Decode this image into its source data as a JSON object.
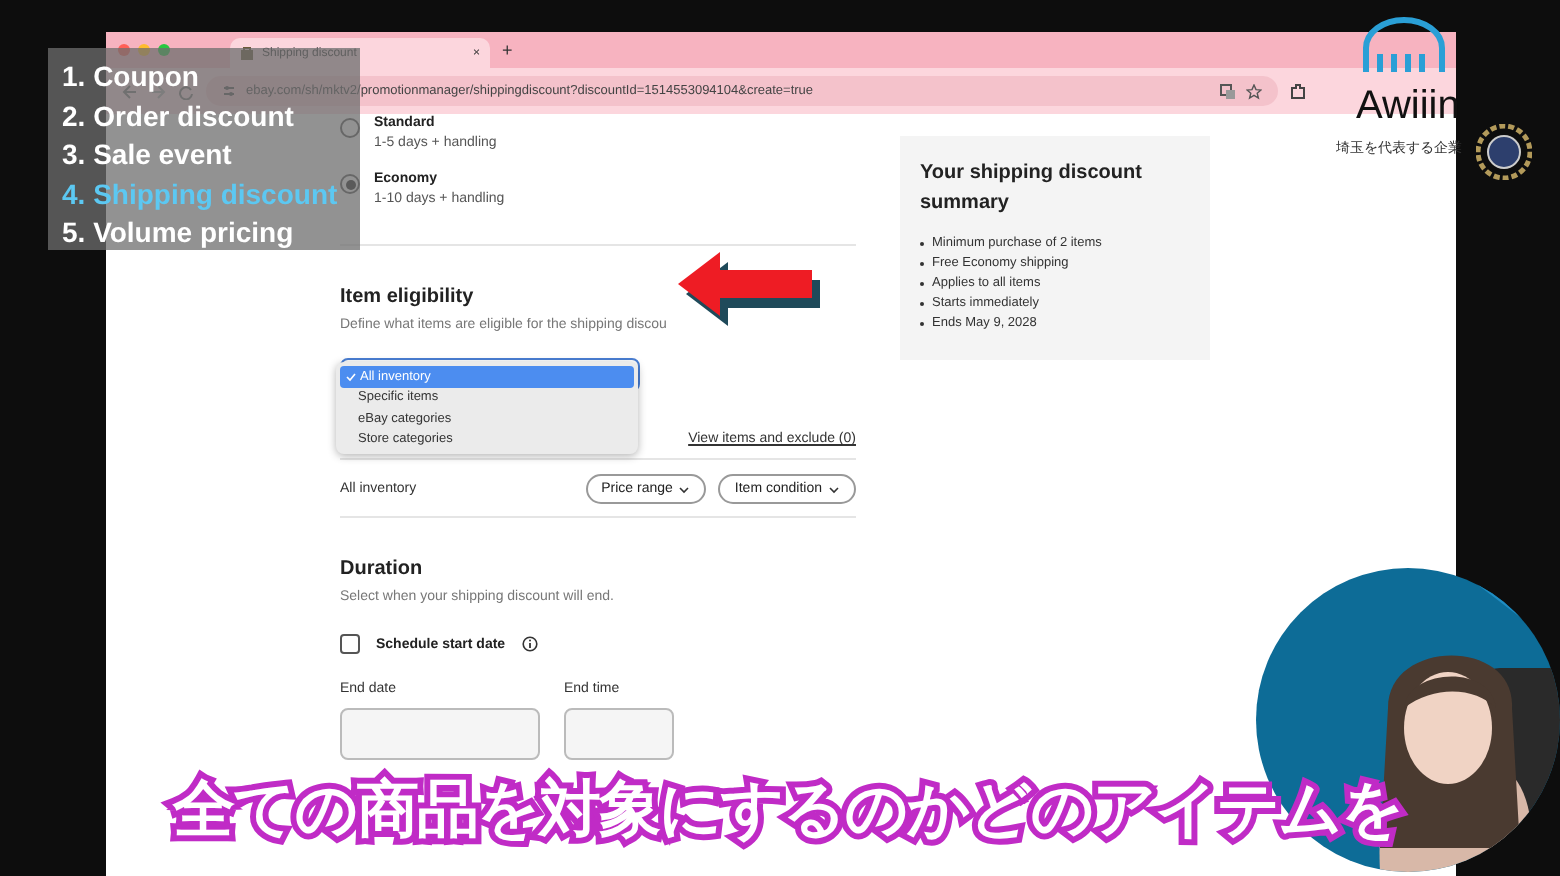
{
  "browser": {
    "tab": {
      "title": "Shipping discount",
      "close": "×"
    },
    "new_tab": "+",
    "url": "ebay.com/sh/mktv2/promotionmanager/shippingdiscount?discountId=1514553094104&create=true"
  },
  "shipping_options": [
    {
      "name": "Standard",
      "detail": "1-5 days + handling",
      "selected": false
    },
    {
      "name": "Economy",
      "detail": "1-10 days + handling",
      "selected": true
    }
  ],
  "item_eligibility": {
    "title": "Item eligibility",
    "description": "Define what items are eligible for the shipping discou",
    "dropdown": {
      "options": [
        {
          "label": "All inventory",
          "selected": true
        },
        {
          "label": "Specific items",
          "selected": false
        },
        {
          "label": "eBay categories",
          "selected": false
        },
        {
          "label": "Store categories",
          "selected": false
        }
      ]
    },
    "link": "View items and exclude (0)",
    "scope": "All inventory",
    "filters": [
      "Price range",
      "Item condition"
    ]
  },
  "duration": {
    "title": "Duration",
    "description": "Select when your shipping discount will end.",
    "schedule_start": {
      "label": "Schedule start date",
      "checked": false
    },
    "end_date": {
      "label": "End date"
    },
    "end_time": {
      "label": "End time"
    }
  },
  "summary": {
    "title": "Your shipping discount summary",
    "items": [
      "Minimum purchase of 2 items",
      "Free Economy shipping",
      "Applies to all items",
      "Starts immediately",
      "Ends May 9, 2028"
    ]
  },
  "overlay_menu": {
    "items": [
      {
        "label": "1. Coupon",
        "selected": false
      },
      {
        "label": "2. Order discount",
        "selected": false
      },
      {
        "label": "3. Sale event",
        "selected": false
      },
      {
        "label": "4. Shipping discount",
        "selected": true
      },
      {
        "label": "5. Volume pricing",
        "selected": false
      }
    ]
  },
  "logo": {
    "name": "Awiiin",
    "tagline": "埼玉を代表する企業"
  },
  "subtitle": "全ての商品を対象にするのかどのアイテムを"
}
